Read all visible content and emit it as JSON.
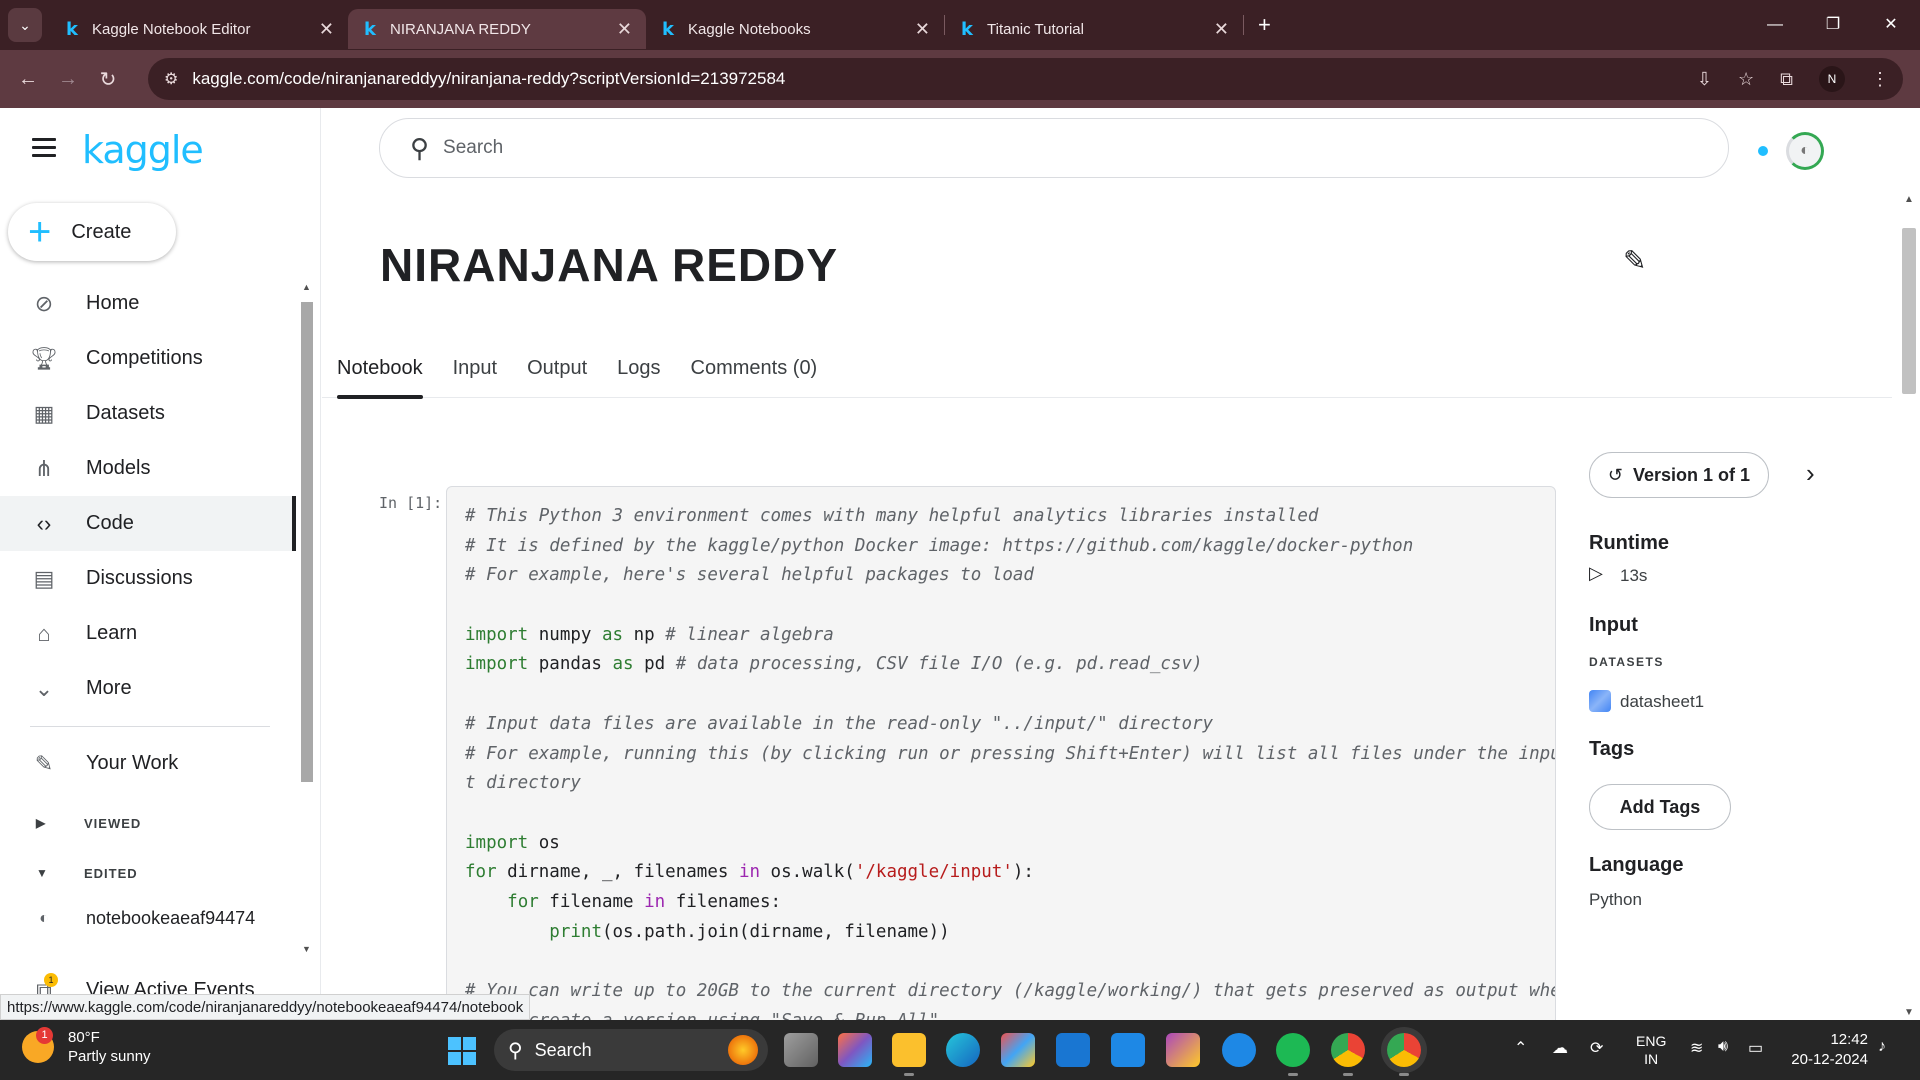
{
  "browser": {
    "tabs": [
      {
        "label": "Kaggle Notebook Editor",
        "active": false
      },
      {
        "label": "NIRANJANA REDDY",
        "active": true
      },
      {
        "label": "Kaggle Notebooks",
        "active": false
      },
      {
        "label": "Titanic Tutorial",
        "active": false
      }
    ],
    "url": "kaggle.com/code/niranjanareddyy/niranjana-reddy?scriptVersionId=213972584",
    "profile_initial": "N",
    "status_url": "https://www.kaggle.com/code/niranjanareddyy/notebookeaeaf94474/notebook"
  },
  "sidebar": {
    "logo": "kaggle",
    "create_label": "Create",
    "nav": [
      {
        "label": "Home",
        "icon": "compass-icon"
      },
      {
        "label": "Competitions",
        "icon": "trophy-icon"
      },
      {
        "label": "Datasets",
        "icon": "table-icon"
      },
      {
        "label": "Models",
        "icon": "models-icon"
      },
      {
        "label": "Code",
        "icon": "code-icon"
      },
      {
        "label": "Discussions",
        "icon": "discussion-icon"
      },
      {
        "label": "Learn",
        "icon": "graduation-cap-icon"
      },
      {
        "label": "More",
        "icon": "chevron-down-icon"
      }
    ],
    "your_work": "Your Work",
    "viewed": "VIEWED",
    "edited": "EDITED",
    "edited_item": "notebookeaeaf94474",
    "active_events": "View Active Events",
    "events_badge": "1"
  },
  "header": {
    "search_placeholder": "Search"
  },
  "notebook": {
    "title": "NIRANJANA REDDY",
    "tabs": [
      "Notebook",
      "Input",
      "Output",
      "Logs",
      "Comments (0)"
    ],
    "prompt": "In [1]:",
    "code_lines": [
      "# This Python 3 environment comes with many helpful analytics libraries installed",
      "# It is defined by the kaggle/python Docker image: https://github.com/kaggle/docker-python",
      "# For example, here's several helpful packages to load",
      "",
      "import numpy as np # linear algebra",
      "import pandas as pd # data processing, CSV file I/O (e.g. pd.read_csv)",
      "",
      "# Input data files are available in the read-only \"../input/\" directory",
      "# For example, running this (by clicking run or pressing Shift+Enter) will list all files under the inpu",
      "t directory",
      "",
      "import os",
      "for dirname, _, filenames in os.walk('/kaggle/input'):",
      "    for filename in filenames:",
      "        print(os.path.join(dirname, filename))",
      "",
      "# You can write up to 20GB to the current directory (/kaggle/working/) that gets preserved as output whe",
      "n you create a version using \"Save & Run All\""
    ]
  },
  "right_panel": {
    "version": "Version 1 of 1",
    "runtime_heading": "Runtime",
    "runtime_value": "13s",
    "input_heading": "Input",
    "datasets_label": "DATASETS",
    "dataset_name": "datasheet1",
    "tags_heading": "Tags",
    "add_tags": "Add Tags",
    "language_heading": "Language",
    "language_value": "Python"
  },
  "taskbar": {
    "temperature": "80°F",
    "weather": "Partly sunny",
    "weather_badge": "1",
    "search": "Search",
    "lang1": "ENG",
    "lang2": "IN",
    "time": "12:42",
    "date": "20-12-2024"
  }
}
